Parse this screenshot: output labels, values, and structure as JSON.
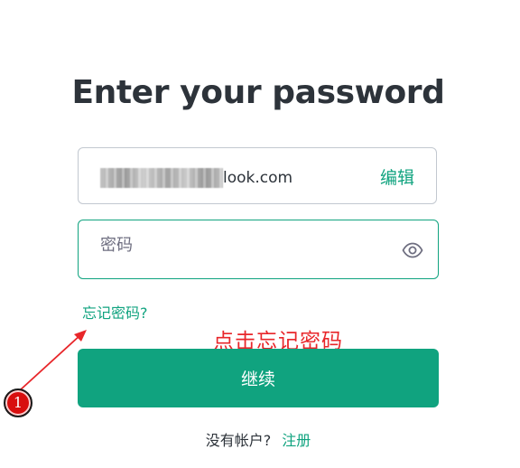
{
  "title": "Enter your password",
  "email": {
    "visible_suffix": "look.com",
    "edit_label": "编辑"
  },
  "password": {
    "placeholder": "密码",
    "value": ""
  },
  "forgot_label": "忘记密码?",
  "annotation": {
    "text": "点击忘记密码",
    "step": "1",
    "color": "#e8262a"
  },
  "continue_label": "继续",
  "signup": {
    "prompt": "没有帐户?",
    "link_label": "注册"
  },
  "colors": {
    "accent": "#10a37f",
    "text": "#2d333a",
    "border": "#c2c8d0"
  },
  "icons": {
    "password_toggle": "eye-icon"
  }
}
